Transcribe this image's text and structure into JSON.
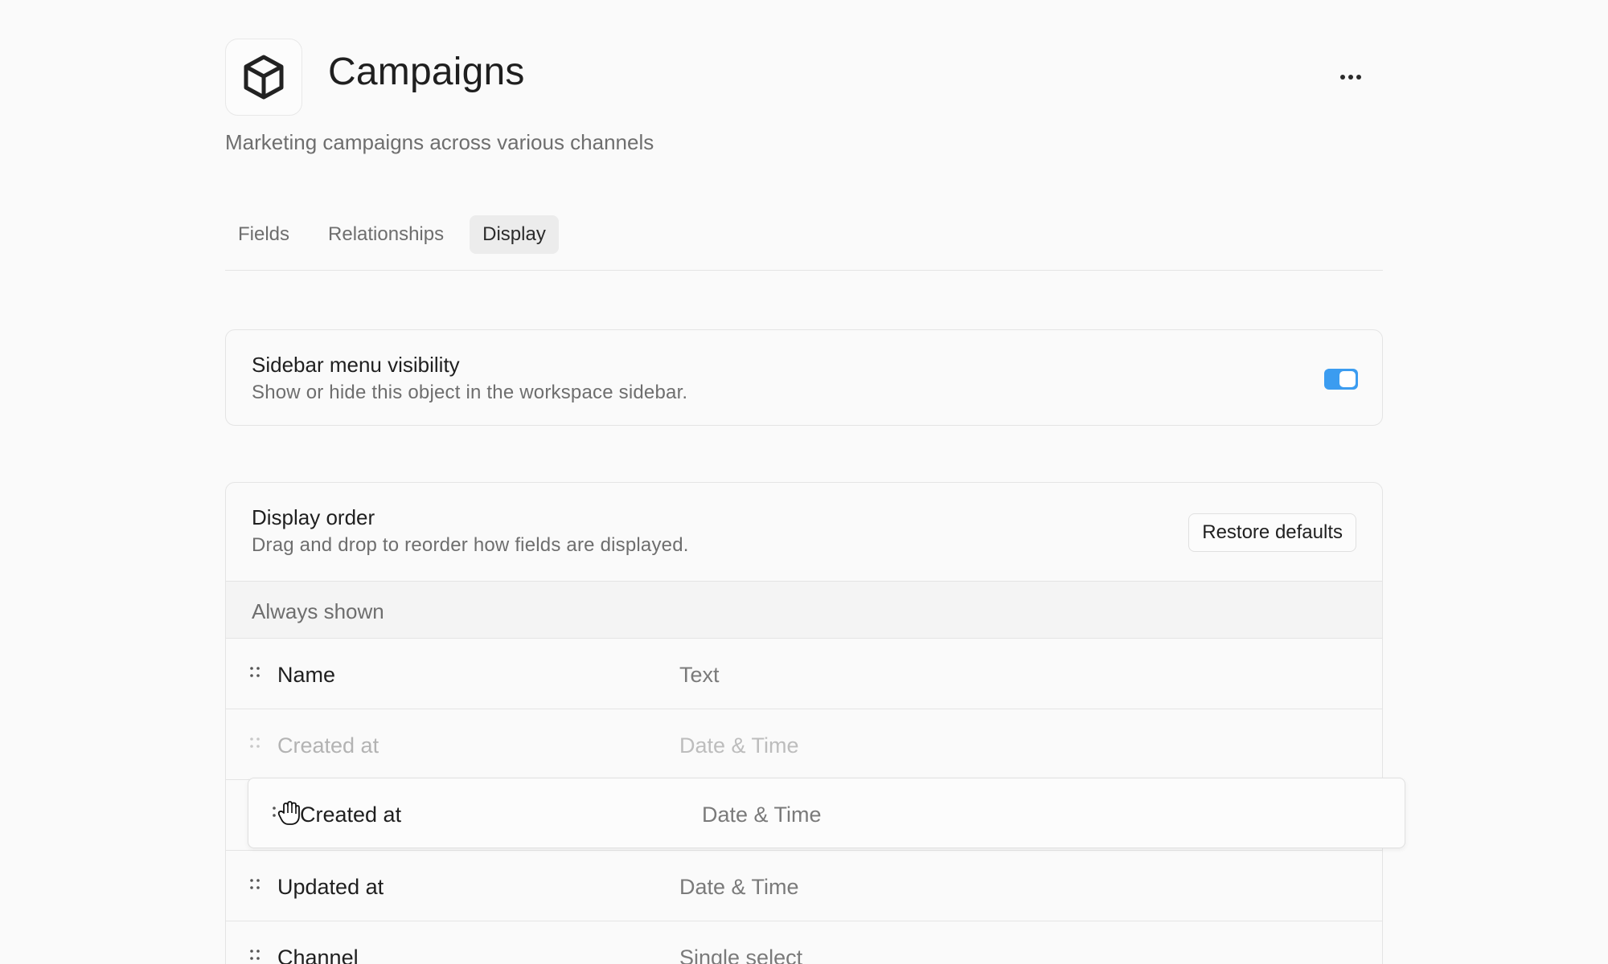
{
  "header": {
    "icon": "cube-icon",
    "title": "Campaigns",
    "subtitle": "Marketing campaigns across various channels",
    "more_icon": "more-horizontal-icon"
  },
  "tabs": [
    {
      "label": "Fields",
      "active": false
    },
    {
      "label": "Relationships",
      "active": false
    },
    {
      "label": "Display",
      "active": true
    }
  ],
  "visibility": {
    "title": "Sidebar menu visibility",
    "description": "Show or hide this object in the workspace sidebar.",
    "enabled": true,
    "accent": "#3b9cf0"
  },
  "display_order": {
    "title": "Display order",
    "description": "Drag and drop to reorder how fields are displayed.",
    "restore_label": "Restore defaults",
    "section_label": "Always shown",
    "rows": [
      {
        "label": "Name",
        "type": "Text"
      },
      {
        "label": "Created at",
        "type": "Date & Time",
        "placeholder": true
      },
      {
        "label": "Updated at",
        "type": "Date & Time"
      },
      {
        "label": "Channel",
        "type": "Single select"
      }
    ],
    "dragging": {
      "label": "Created at",
      "type": "Date & Time",
      "cursor_icon": "grab-hand-icon"
    }
  }
}
